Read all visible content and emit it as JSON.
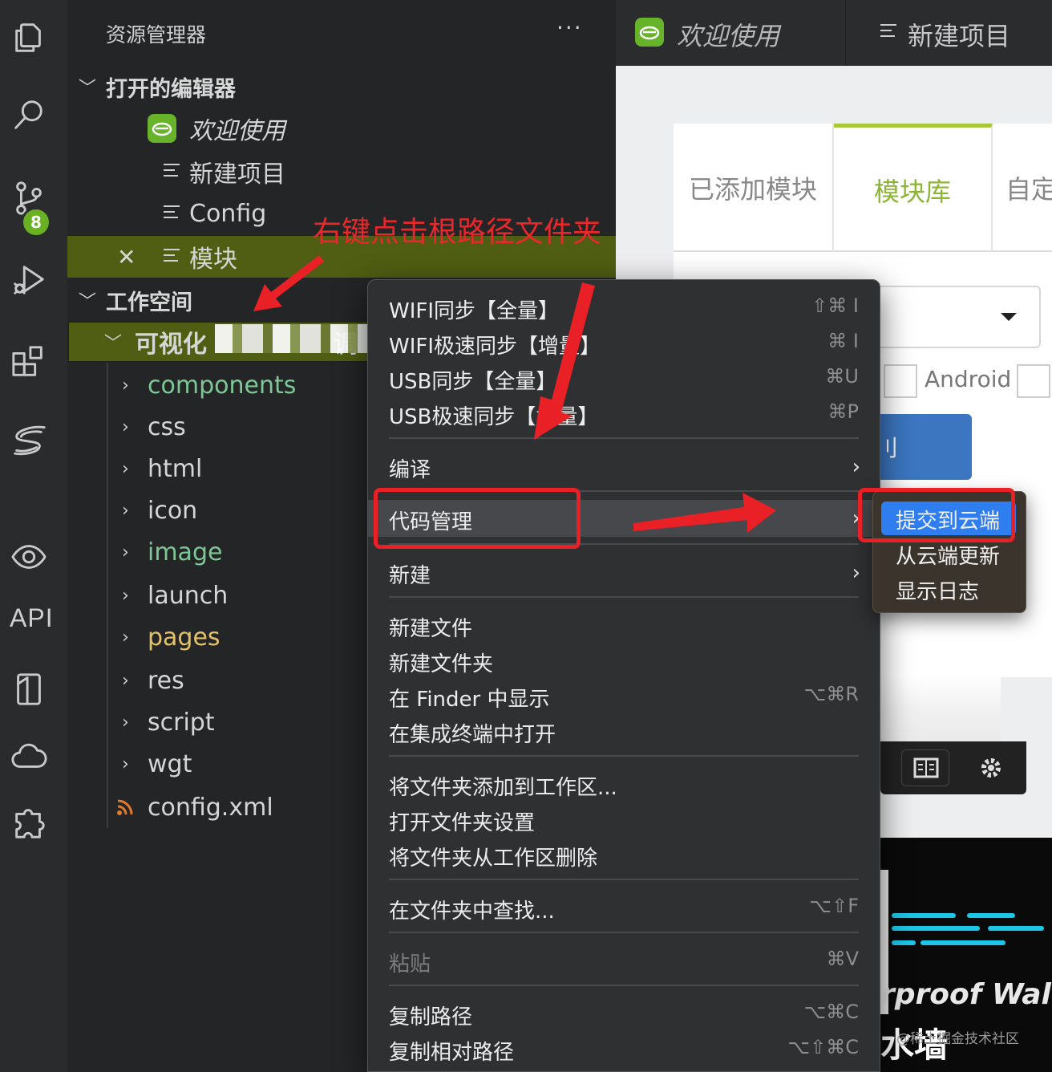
{
  "activity_bar": {
    "source_control_badge": "8",
    "api_label": "API",
    "icons": [
      "files-icon",
      "search-icon",
      "source-control-icon",
      "run-debug-icon",
      "extensions-icon",
      "hbuilder-s-icon",
      "preview-eye-icon",
      "api-label",
      "phone-frame-icon",
      "cloud-icon",
      "plugin-puzzle-icon"
    ]
  },
  "sidebar": {
    "title": "资源管理器",
    "more": "···",
    "open_editors": {
      "label": "打开的编辑器",
      "items": [
        {
          "label": "欢迎使用",
          "icon": "hbuilder-logo-icon"
        },
        {
          "label": "新建项目",
          "icon": "lines-icon"
        },
        {
          "label": "Config",
          "icon": "lines-icon"
        },
        {
          "label": "模块",
          "icon": "lines-icon",
          "close": "✕"
        }
      ]
    },
    "workspace": {
      "label": "工作空间",
      "project": "可视化",
      "project_tail": "调",
      "children": [
        {
          "label": "components",
          "color": "#7ec896"
        },
        {
          "label": "css"
        },
        {
          "label": "html"
        },
        {
          "label": "icon"
        },
        {
          "label": "image",
          "color": "#7ec896"
        },
        {
          "label": "launch"
        },
        {
          "label": "pages",
          "color": "#e3c26a"
        },
        {
          "label": "res"
        },
        {
          "label": "script"
        },
        {
          "label": "wgt"
        },
        {
          "label": "config.xml",
          "icon": "rss-icon"
        }
      ]
    }
  },
  "annotation": {
    "text": "右键点击根路径文件夹",
    "color": "#e8282a"
  },
  "tabs": [
    {
      "label": "欢迎使用"
    },
    {
      "label": "新建项目"
    }
  ],
  "editor": {
    "panel_tabs": [
      "已添加模块",
      "模块库",
      "自定"
    ],
    "active_tab": "模块库",
    "android": "Android",
    "button": "刂",
    "wall_text": "rproof Wall",
    "wall_cn": "水墙"
  },
  "context_menu": {
    "groups": [
      [
        {
          "label": "WIFI同步【全量】",
          "shortcut": "⇧⌘ I"
        },
        {
          "label": "WIFI极速同步【增量】",
          "shortcut": "⌘ I"
        },
        {
          "label": "USB同步【全量】",
          "shortcut": "⌘U"
        },
        {
          "label": "USB极速同步【增量】",
          "shortcut": "⌘P"
        }
      ],
      [
        {
          "label": "编译",
          "submenu": "›"
        }
      ],
      [
        {
          "label": "代码管理",
          "submenu": "›",
          "highlighted": true
        }
      ],
      [
        {
          "label": "新建",
          "submenu": "›"
        }
      ],
      [
        {
          "label": "新建文件"
        },
        {
          "label": "新建文件夹"
        },
        {
          "label": "在 Finder 中显示",
          "shortcut": "⌥⌘R"
        },
        {
          "label": "在集成终端中打开"
        }
      ],
      [
        {
          "label": "将文件夹添加到工作区..."
        },
        {
          "label": "打开文件夹设置"
        },
        {
          "label": "将文件夹从工作区删除"
        }
      ],
      [
        {
          "label": "在文件夹中查找...",
          "shortcut": "⌥⇧F"
        }
      ],
      [
        {
          "label": "粘贴",
          "shortcut": "⌘V",
          "disabled": true
        }
      ],
      [
        {
          "label": "复制路径",
          "shortcut": "⌥⌘C"
        },
        {
          "label": "复制相对路径",
          "shortcut": "⌥⇧⌘C"
        }
      ]
    ]
  },
  "submenu": {
    "items": [
      {
        "label": "提交到云端",
        "highlighted": true
      },
      {
        "label": "从云端更新"
      },
      {
        "label": "显示日志"
      }
    ]
  },
  "watermark": "@稀土掘金技术社区"
}
